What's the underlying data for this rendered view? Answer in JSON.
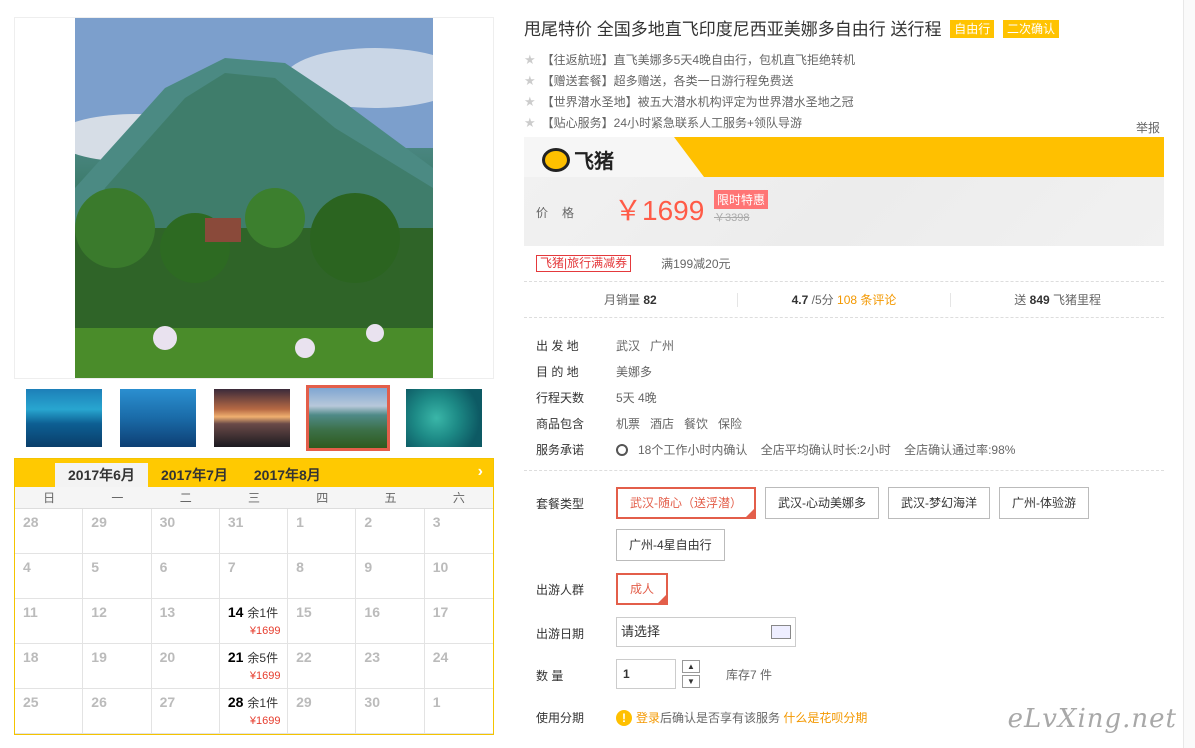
{
  "product": {
    "title": "甩尾特价 全国多地直飞印度尼西亚美娜多自由行 送行程",
    "tags": [
      "自由行",
      "二次确认"
    ],
    "features": [
      "【往返航班】直飞美娜多5天4晚自由行，包机直飞拒绝转机",
      "【赠送套餐】超多赠送，各类一日游行程免费送",
      "【世界潜水圣地】被五大潜水机构评定为世界潜水圣地之冠",
      "【贴心服务】24小时紧急联系人工服务+领队导游"
    ],
    "report": "举报"
  },
  "brand": {
    "name": "飞猪",
    "icon": "pig-logo-icon"
  },
  "price": {
    "label": "价格",
    "current": "￥1699",
    "badge": "限时特惠",
    "original": "￥3398"
  },
  "coupon": {
    "label": "飞猪|旅行满减券",
    "desc": "满199减20元"
  },
  "stats": {
    "sales_label": "月销量",
    "sales": "82",
    "rating": "4.7",
    "rating_suffix": "/5分",
    "reviews": "108 条评论",
    "miles_prefix": "送",
    "miles": "849",
    "miles_suffix": "飞猪里程"
  },
  "info": {
    "depart_label": "出 发 地",
    "depart": [
      "武汉",
      "广州"
    ],
    "dest_label": "目 的 地",
    "dest": "美娜多",
    "days_label": "行程天数",
    "days": "5天 4晚",
    "include_label": "商品包含",
    "include": [
      "机票",
      "酒店",
      "餐饮",
      "保险"
    ],
    "promise_label": "服务承诺",
    "promise": [
      "18个工作小时内确认",
      "全店平均确认时长:2小时",
      "全店确认通过率:98%"
    ]
  },
  "options": {
    "package_label": "套餐类型",
    "packages": [
      "武汉-随心（送浮潜）",
      "武汉-心动美娜多",
      "武汉-梦幻海洋",
      "广州-体验游",
      "广州-4星自由行"
    ],
    "group_label": "出游人群",
    "groups": [
      "成人"
    ],
    "date_label": "出游日期",
    "date_value": "请选择",
    "qty_label": "数 量",
    "qty_value": "1",
    "stock": "库存7 件",
    "install_label": "使用分期",
    "install_login": "登录",
    "install_text": "后确认是否享有该服务",
    "install_link": "什么是花呗分期"
  },
  "calendar": {
    "months": [
      "2017年6月",
      "2017年7月",
      "2017年8月"
    ],
    "weekdays": [
      "日",
      "一",
      "二",
      "三",
      "四",
      "五",
      "六"
    ],
    "days": [
      {
        "d": "28"
      },
      {
        "d": "29"
      },
      {
        "d": "30"
      },
      {
        "d": "31"
      },
      {
        "d": "1"
      },
      {
        "d": "2"
      },
      {
        "d": "3"
      },
      {
        "d": "4"
      },
      {
        "d": "5"
      },
      {
        "d": "6"
      },
      {
        "d": "7"
      },
      {
        "d": "8"
      },
      {
        "d": "9"
      },
      {
        "d": "10"
      },
      {
        "d": "11"
      },
      {
        "d": "12"
      },
      {
        "d": "13"
      },
      {
        "d": "14",
        "stock": "余1件",
        "price": "¥1699"
      },
      {
        "d": "15"
      },
      {
        "d": "16"
      },
      {
        "d": "17"
      },
      {
        "d": "18"
      },
      {
        "d": "19"
      },
      {
        "d": "20"
      },
      {
        "d": "21",
        "stock": "余5件",
        "price": "¥1699"
      },
      {
        "d": "22"
      },
      {
        "d": "23"
      },
      {
        "d": "24"
      },
      {
        "d": "25"
      },
      {
        "d": "26"
      },
      {
        "d": "27"
      },
      {
        "d": "28",
        "stock": "余1件",
        "price": "¥1699"
      },
      {
        "d": "29"
      },
      {
        "d": "30"
      },
      {
        "d": "1"
      }
    ]
  },
  "watermark": "eLvXing.net"
}
